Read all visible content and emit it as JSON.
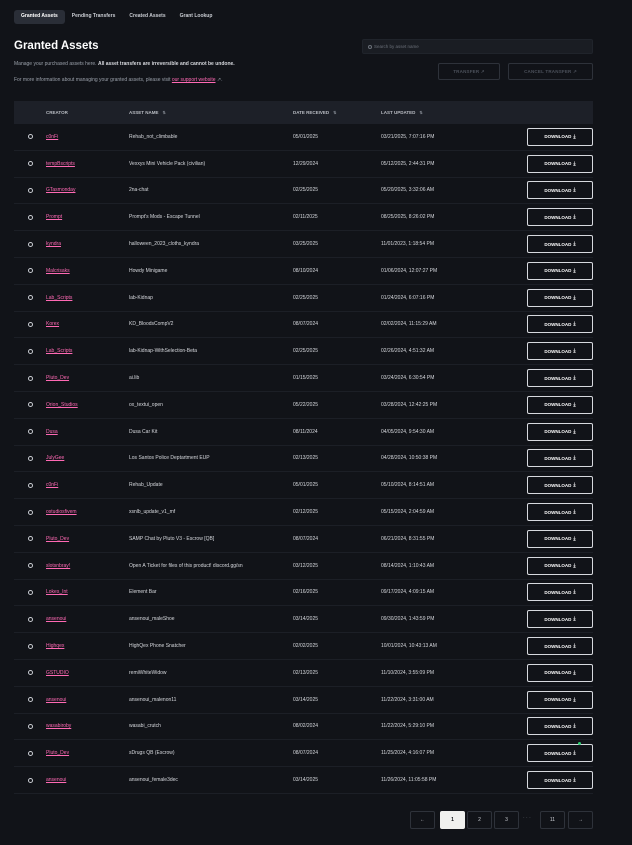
{
  "tabs": [
    "Granted Assets",
    "Pending Transfers",
    "Created Assets",
    "Grant Lookup"
  ],
  "active_tab": 0,
  "page": {
    "title": "Granted Assets",
    "desc_plain": "Manage your purchased assets here. ",
    "desc_bold": "All asset transfers are irreversible and cannot be undone.",
    "info_prefix": "For more information about managing your granted assets, please visit ",
    "info_link": "our support website",
    "info_link_icon": "↗",
    "info_suffix": "."
  },
  "search": {
    "placeholder": "Search by asset name",
    "icon": "search-icon"
  },
  "actions": {
    "transfer": "TRANSFER ↗",
    "cancel_transfer": "CANCEL TRANSFER ↗"
  },
  "table": {
    "headers": {
      "creator": "CREATOR",
      "asset": "ASSET NAME",
      "date": "DATE RECEIVED",
      "updated": "LAST UPDATED",
      "sort_icon": "⇅"
    },
    "download_label": "DOWNLOAD",
    "download_icon": "⤓",
    "rows": [
      {
        "creator": "c0nFi",
        "asset": "Rehab_not_climbable",
        "date": "05/01/2025",
        "updated": "03/21/2025, 7:07:16 PM"
      },
      {
        "creator": "tempBscripts",
        "asset": "Vexxys Mini Vehicle Pack (civilian)",
        "date": "12/29/2024",
        "updated": "05/12/2025, 2:44:31 PM"
      },
      {
        "creator": "GTasmonday",
        "asset": "2na-chat",
        "date": "02/25/2025",
        "updated": "05/20/2025, 3:32:06 AM"
      },
      {
        "creator": "Prompt",
        "asset": "Prompt's Mods - Escape Tunnel",
        "date": "02/11/2025",
        "updated": "08/25/2025, 8:26:02 PM"
      },
      {
        "creator": "kyndra",
        "asset": "halloween_2023_cloths_kyndra",
        "date": "03/25/2025",
        "updated": "11/01/2023, 1:18:54 PM"
      },
      {
        "creator": "Malcrisaks",
        "asset": "Howdy Minigame",
        "date": "08/10/2024",
        "updated": "01/06/2024, 12:07:27 PM"
      },
      {
        "creator": "Lab_Scripts",
        "asset": "lab-Kidnap",
        "date": "02/25/2025",
        "updated": "01/24/2024, 6:07:16 PM"
      },
      {
        "creator": "Korex",
        "asset": "KD_BloodsCompV2",
        "date": "08/07/2024",
        "updated": "02/02/2024, 11:15:29 AM"
      },
      {
        "creator": "Lab_Scripts",
        "asset": "lab-Kidnap-WithSelection-Beta",
        "date": "02/25/2025",
        "updated": "02/26/2024, 4:51:32 AM"
      },
      {
        "creator": "Pluto_Dev",
        "asset": "ai.lib",
        "date": "01/15/2025",
        "updated": "03/24/2024, 6:30:54 PM"
      },
      {
        "creator": "Orion_Studios",
        "asset": "ox_textui_open",
        "date": "05/22/2025",
        "updated": "03/28/2024, 12:42:25 PM"
      },
      {
        "creator": "Dusa",
        "asset": "Dusa Car Kit",
        "date": "08/11/2024",
        "updated": "04/05/2024, 9:54:30 AM"
      },
      {
        "creator": "JulyGee",
        "asset": "Los Santos Police Deptartment EUP",
        "date": "02/13/2025",
        "updated": "04/28/2024, 10:50:38 PM"
      },
      {
        "creator": "c0nFi",
        "asset": "Rehab_Update",
        "date": "05/01/2025",
        "updated": "05/10/2024, 8:14:51 AM"
      },
      {
        "creator": "ostudiosfivem",
        "asset": "xsnlb_update_v1_mf",
        "date": "02/12/2025",
        "updated": "05/15/2024, 2:04:59 AM"
      },
      {
        "creator": "Pluto_Dev",
        "asset": "SAMP Chat by Pluto V3 - Escrow [QB]",
        "date": "08/07/2024",
        "updated": "06/21/2024, 8:31:55 PM"
      },
      {
        "creator": "slotsnbray!",
        "asset": "Open A Ticket for files of this product! discord.gg/sn",
        "date": "03/12/2025",
        "updated": "08/14/2024, 1:10:43 AM"
      },
      {
        "creator": "Lokes_Int",
        "asset": "Element Bar",
        "date": "02/16/2025",
        "updated": "09/17/2024, 4:09:15 AM"
      },
      {
        "creator": "ansenoui",
        "asset": "ansenoui_maleShoe",
        "date": "03/14/2025",
        "updated": "09/30/2024, 1:43:59 PM"
      },
      {
        "creator": "Highqex",
        "asset": "HighQex Phone Snatcher",
        "date": "02/02/2025",
        "updated": "10/01/2024, 10:43:13 AM"
      },
      {
        "creator": "GSTUDIO",
        "asset": "remiWhiteWidow",
        "date": "02/13/2025",
        "updated": "11/10/2024, 3:55:09 PM"
      },
      {
        "creator": "ansenoui",
        "asset": "ansenoui_malenon11",
        "date": "03/14/2025",
        "updated": "11/22/2024, 3:31:00 AM"
      },
      {
        "creator": "wasabiroby",
        "asset": "wasabi_crutch",
        "date": "08/02/2024",
        "updated": "11/22/2024, 5:29:10 PM"
      },
      {
        "creator": "Pluto_Dev",
        "asset": "sDrugs QB (Escrow)",
        "date": "08/07/2024",
        "updated": "11/25/2024, 4:16:07 PM"
      },
      {
        "creator": "ansenoui",
        "asset": "ansenoui_female3dec",
        "date": "03/14/2025",
        "updated": "11/26/2024, 11:05:58 PM"
      }
    ]
  },
  "pagination": {
    "prev": "←",
    "pages": [
      "1",
      "2",
      "3"
    ],
    "dots": "· · ·",
    "last": "11",
    "next": "→",
    "current": "1"
  }
}
